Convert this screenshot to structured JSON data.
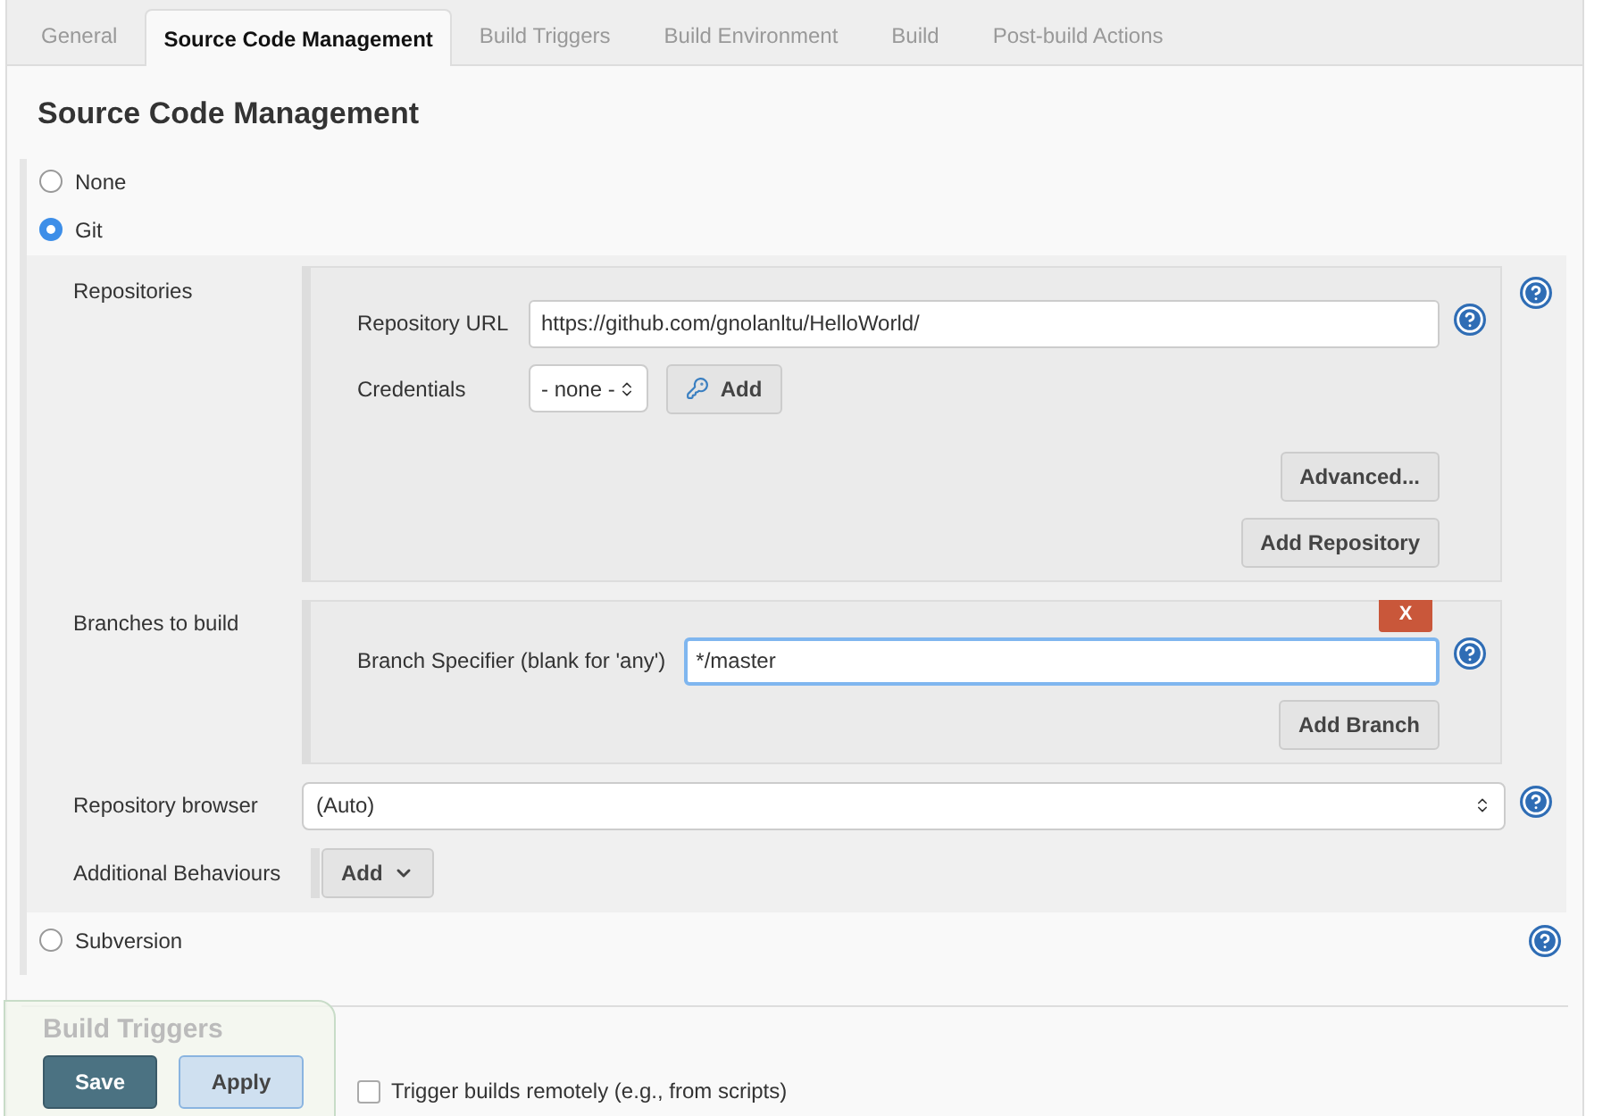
{
  "tabs": [
    {
      "label": "General",
      "selected": false
    },
    {
      "label": "Source Code Management",
      "selected": true
    },
    {
      "label": "Build Triggers",
      "selected": false
    },
    {
      "label": "Build Environment",
      "selected": false
    },
    {
      "label": "Build",
      "selected": false
    },
    {
      "label": "Post-build Actions",
      "selected": false
    }
  ],
  "section": {
    "title": "Source Code Management"
  },
  "scm_options": [
    {
      "label": "None",
      "selected": false
    },
    {
      "label": "Git",
      "selected": true
    },
    {
      "label": "Subversion",
      "selected": false
    }
  ],
  "git": {
    "repositories": {
      "label": "Repositories",
      "url_label": "Repository URL",
      "url_value": "https://github.com/gnolanltu/HelloWorld/",
      "credentials_label": "Credentials",
      "credentials_value": "- none -",
      "add_credentials_button": "Add",
      "advanced_button": "Advanced...",
      "add_repository_button": "Add Repository"
    },
    "branches": {
      "label": "Branches to build",
      "remove_button": "X",
      "specifier_label": "Branch Specifier (blank for 'any')",
      "specifier_value": "*/master",
      "add_branch_button": "Add Branch"
    },
    "repository_browser": {
      "label": "Repository browser",
      "value": "(Auto)"
    },
    "additional_behaviours": {
      "label": "Additional Behaviours",
      "add_button": "Add"
    }
  },
  "next_section": {
    "title": "Build Triggers",
    "first_option": {
      "label": "Trigger builds remotely (e.g., from scripts)",
      "checked": false
    }
  },
  "footer_buttons": {
    "save": "Save",
    "apply": "Apply"
  }
}
